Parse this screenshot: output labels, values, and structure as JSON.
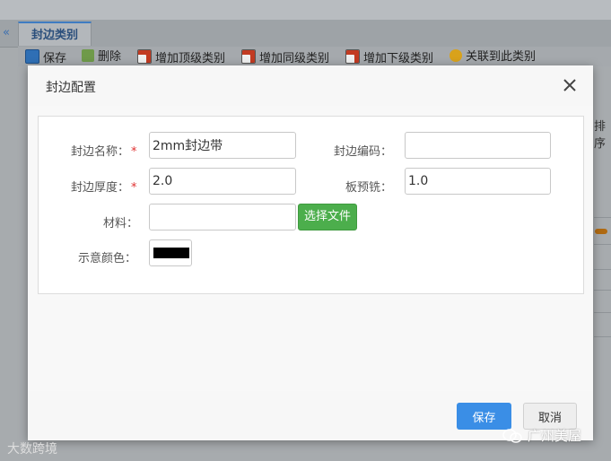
{
  "background": {
    "tab_label": "封边类别",
    "collapse_icon": "«",
    "right_fragment": "排序",
    "toolbar": [
      {
        "label": "保存",
        "icon": "save-icon",
        "color": "#2f6fb5"
      },
      {
        "label": "删除",
        "icon": "trash-icon",
        "color": "#5a8a3a"
      },
      {
        "label": "增加顶级类别",
        "icon": "add-doc-icon",
        "color": "#c23b22"
      },
      {
        "label": "增加同级类别",
        "icon": "add-doc-icon",
        "color": "#c23b22"
      },
      {
        "label": "增加下级类别",
        "icon": "add-doc-icon",
        "color": "#c23b22"
      },
      {
        "label": "关联到此类别",
        "icon": "link-icon",
        "color": "#d9a21b"
      }
    ]
  },
  "dialog": {
    "title": "封边配置",
    "fields": {
      "name_label": "封边名称：",
      "name_value": "2mm封边带",
      "code_label": "封边编码：",
      "code_value": "",
      "thickness_label": "封边厚度：",
      "thickness_value": "2.0",
      "premill_label": "板预铣：",
      "premill_value": "1.0",
      "material_label": "材料：",
      "material_value": "",
      "choose_file": "选择文件",
      "color_label": "示意颜色：",
      "color_value": "#000000",
      "required_mark": "*"
    },
    "save": "保存",
    "cancel": "取消"
  },
  "watermarks": {
    "left": "大数跨境",
    "right": "广州美屋"
  }
}
